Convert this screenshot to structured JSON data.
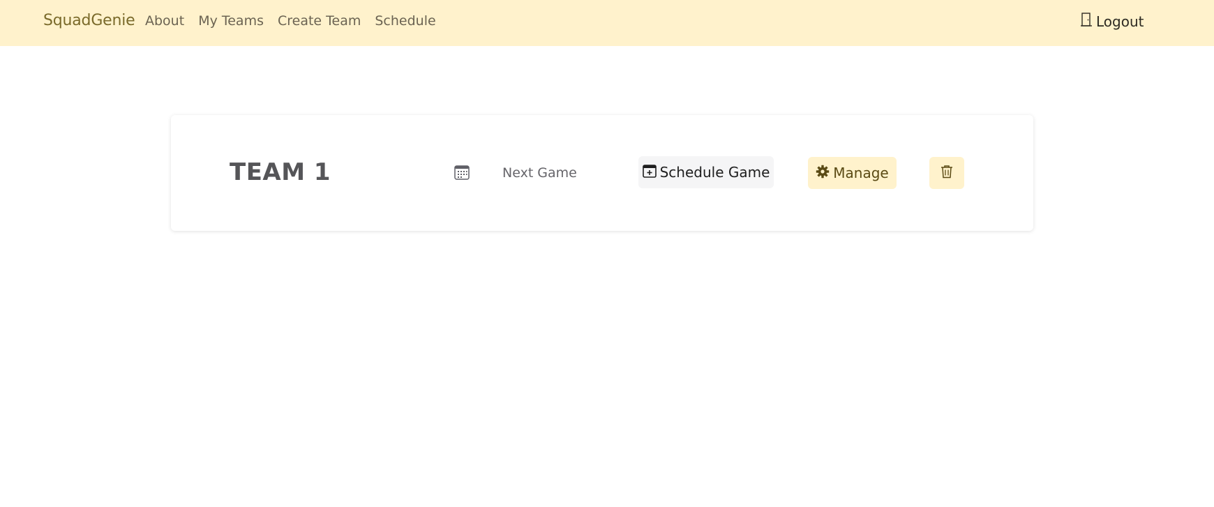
{
  "navbar": {
    "brand": "SquadGenie",
    "links": [
      {
        "label": "About"
      },
      {
        "label": "My Teams"
      },
      {
        "label": "Create Team"
      },
      {
        "label": "Schedule"
      }
    ],
    "logout_label": "Logout",
    "logout_icon": "door-icon",
    "background_color": "#fff2cc"
  },
  "team_card": {
    "team_name": "TEAM 1",
    "calendar_icon": "calendar-icon",
    "next_game_label": "Next Game",
    "schedule_button_label": "Schedule Game",
    "schedule_icon": "calendar-plus-icon",
    "manage_button_label": "Manage",
    "manage_icon": "gear-icon",
    "delete_icon": "trash-icon"
  }
}
